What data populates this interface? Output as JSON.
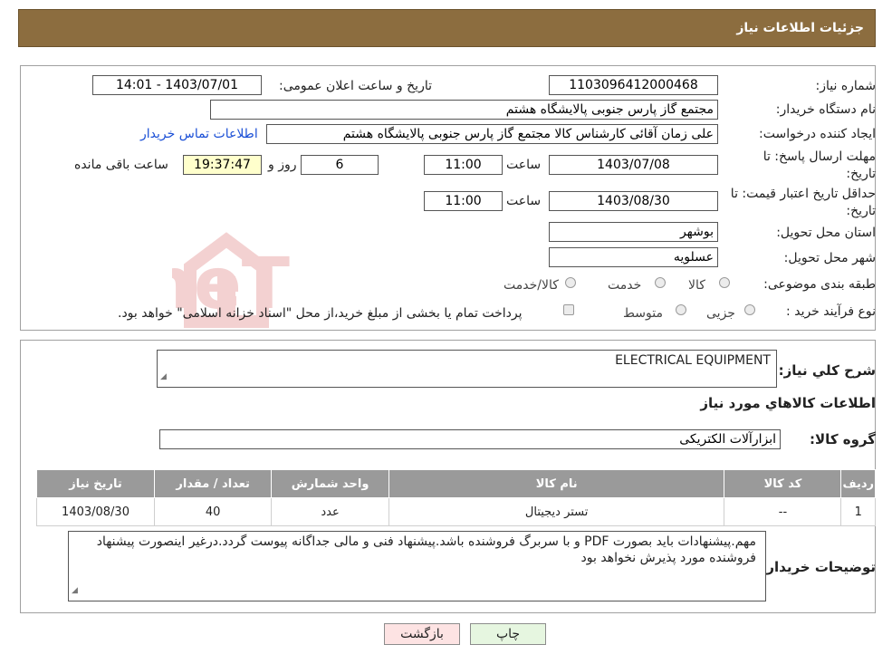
{
  "header": {
    "title": "جزئیات اطلاعات نیاز"
  },
  "form": {
    "need_number_label": "شماره نیاز:",
    "need_number": "1103096412000468",
    "announce_label": "تاریخ و ساعت اعلان عمومی:",
    "announce_value": "1403/07/01 - 14:01",
    "buyer_org_label": "نام دستگاه خریدار:",
    "buyer_org": "مجتمع گاز پارس جنوبی  پالایشگاه هشتم",
    "creator_label": "ایجاد کننده درخواست:",
    "creator": "علی زمان آقائی کارشناس کالا مجتمع گاز پارس جنوبی  پالایشگاه هشتم",
    "contact_link": "اطلاعات تماس خریدار",
    "deadline_label_1": "مهلت ارسال پاسخ: تا",
    "deadline_label_2": "تاریخ:",
    "deadline_date": "1403/07/08",
    "time_label": "ساعت",
    "deadline_time": "11:00",
    "days": "6",
    "days_label": "روز و",
    "remaining_time": "19:37:47",
    "remaining_label": "ساعت باقی مانده",
    "validity_label_1": "حداقل تاریخ اعتبار قیمت: تا",
    "validity_label_2": "تاریخ:",
    "validity_date": "1403/08/30",
    "validity_time": "11:00",
    "province_label": "استان محل تحویل:",
    "province": "بوشهر",
    "city_label": "شهر محل تحویل:",
    "city": "عسلویه",
    "category_label": "طبقه بندی موضوعی:",
    "category_options": [
      "کالا",
      "خدمت",
      "کالا/خدمت"
    ],
    "process_label": "نوع فرآیند خرید :",
    "process_options": [
      "جزیی",
      "متوسط"
    ],
    "process_note": "پرداخت تمام یا بخشی از مبلغ خرید،از محل \"اسناد خزانه اسلامی\" خواهد بود."
  },
  "details": {
    "summary_label": "شرح کلي نياز:",
    "summary": "ELECTRICAL EQUIPMENT",
    "items_heading": "اطلاعات کالاهاي مورد نياز",
    "group_label": "گروه کالا:",
    "group": "ابزارآلات الکتریکی",
    "table": {
      "headers": [
        "رديف",
        "کد کالا",
        "نام کالا",
        "واحد شمارش",
        "تعداد / مقدار",
        "تاريخ نياز"
      ],
      "rows": [
        [
          "1",
          "--",
          "تستر دیجیتال",
          "عدد",
          "40",
          "1403/08/30"
        ]
      ]
    },
    "notes_label": "توضيحات خريدار:",
    "notes": "مهم.پیشنهادات باید بصورت PDF و با سربرگ فروشنده باشد.پیشنهاد فنی و مالی جداگانه پیوست گردد.درغیر اینصورت پیشنهاد فروشنده مورد پذیرش نخواهد بود"
  },
  "buttons": {
    "print": "چاپ",
    "back": "بازگشت"
  },
  "watermark": {
    "text": "AriaTender.neT"
  },
  "colors": {
    "header_bg": "#8c6d3f",
    "table_header_bg": "#9a9a9a",
    "link": "#1a4fd6",
    "back_bg": "#fde3e3",
    "print_bg": "#e6f6e0"
  }
}
